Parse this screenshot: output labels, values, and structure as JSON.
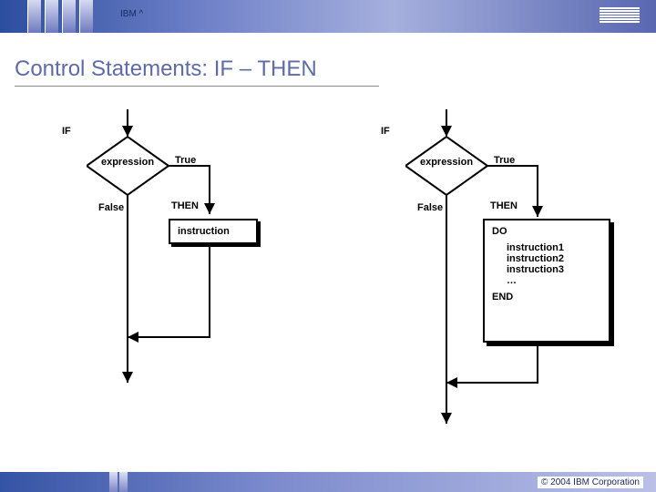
{
  "header": {
    "brand": "IBM ^",
    "logo": "IBM"
  },
  "title": "Control Statements: IF – THEN",
  "flow_left": {
    "if": "IF",
    "expr": "expression",
    "true": "True",
    "false": "False",
    "then": "THEN",
    "instr": "instruction"
  },
  "flow_right": {
    "if": "IF",
    "expr": "expression",
    "true": "True",
    "false": "False",
    "then": "THEN",
    "do": "DO",
    "i1": "instruction1",
    "i2": "instruction2",
    "i3": "instruction3",
    "dots": "…",
    "end": "END"
  },
  "footer": {
    "copyright": "© 2004 IBM Corporation"
  }
}
